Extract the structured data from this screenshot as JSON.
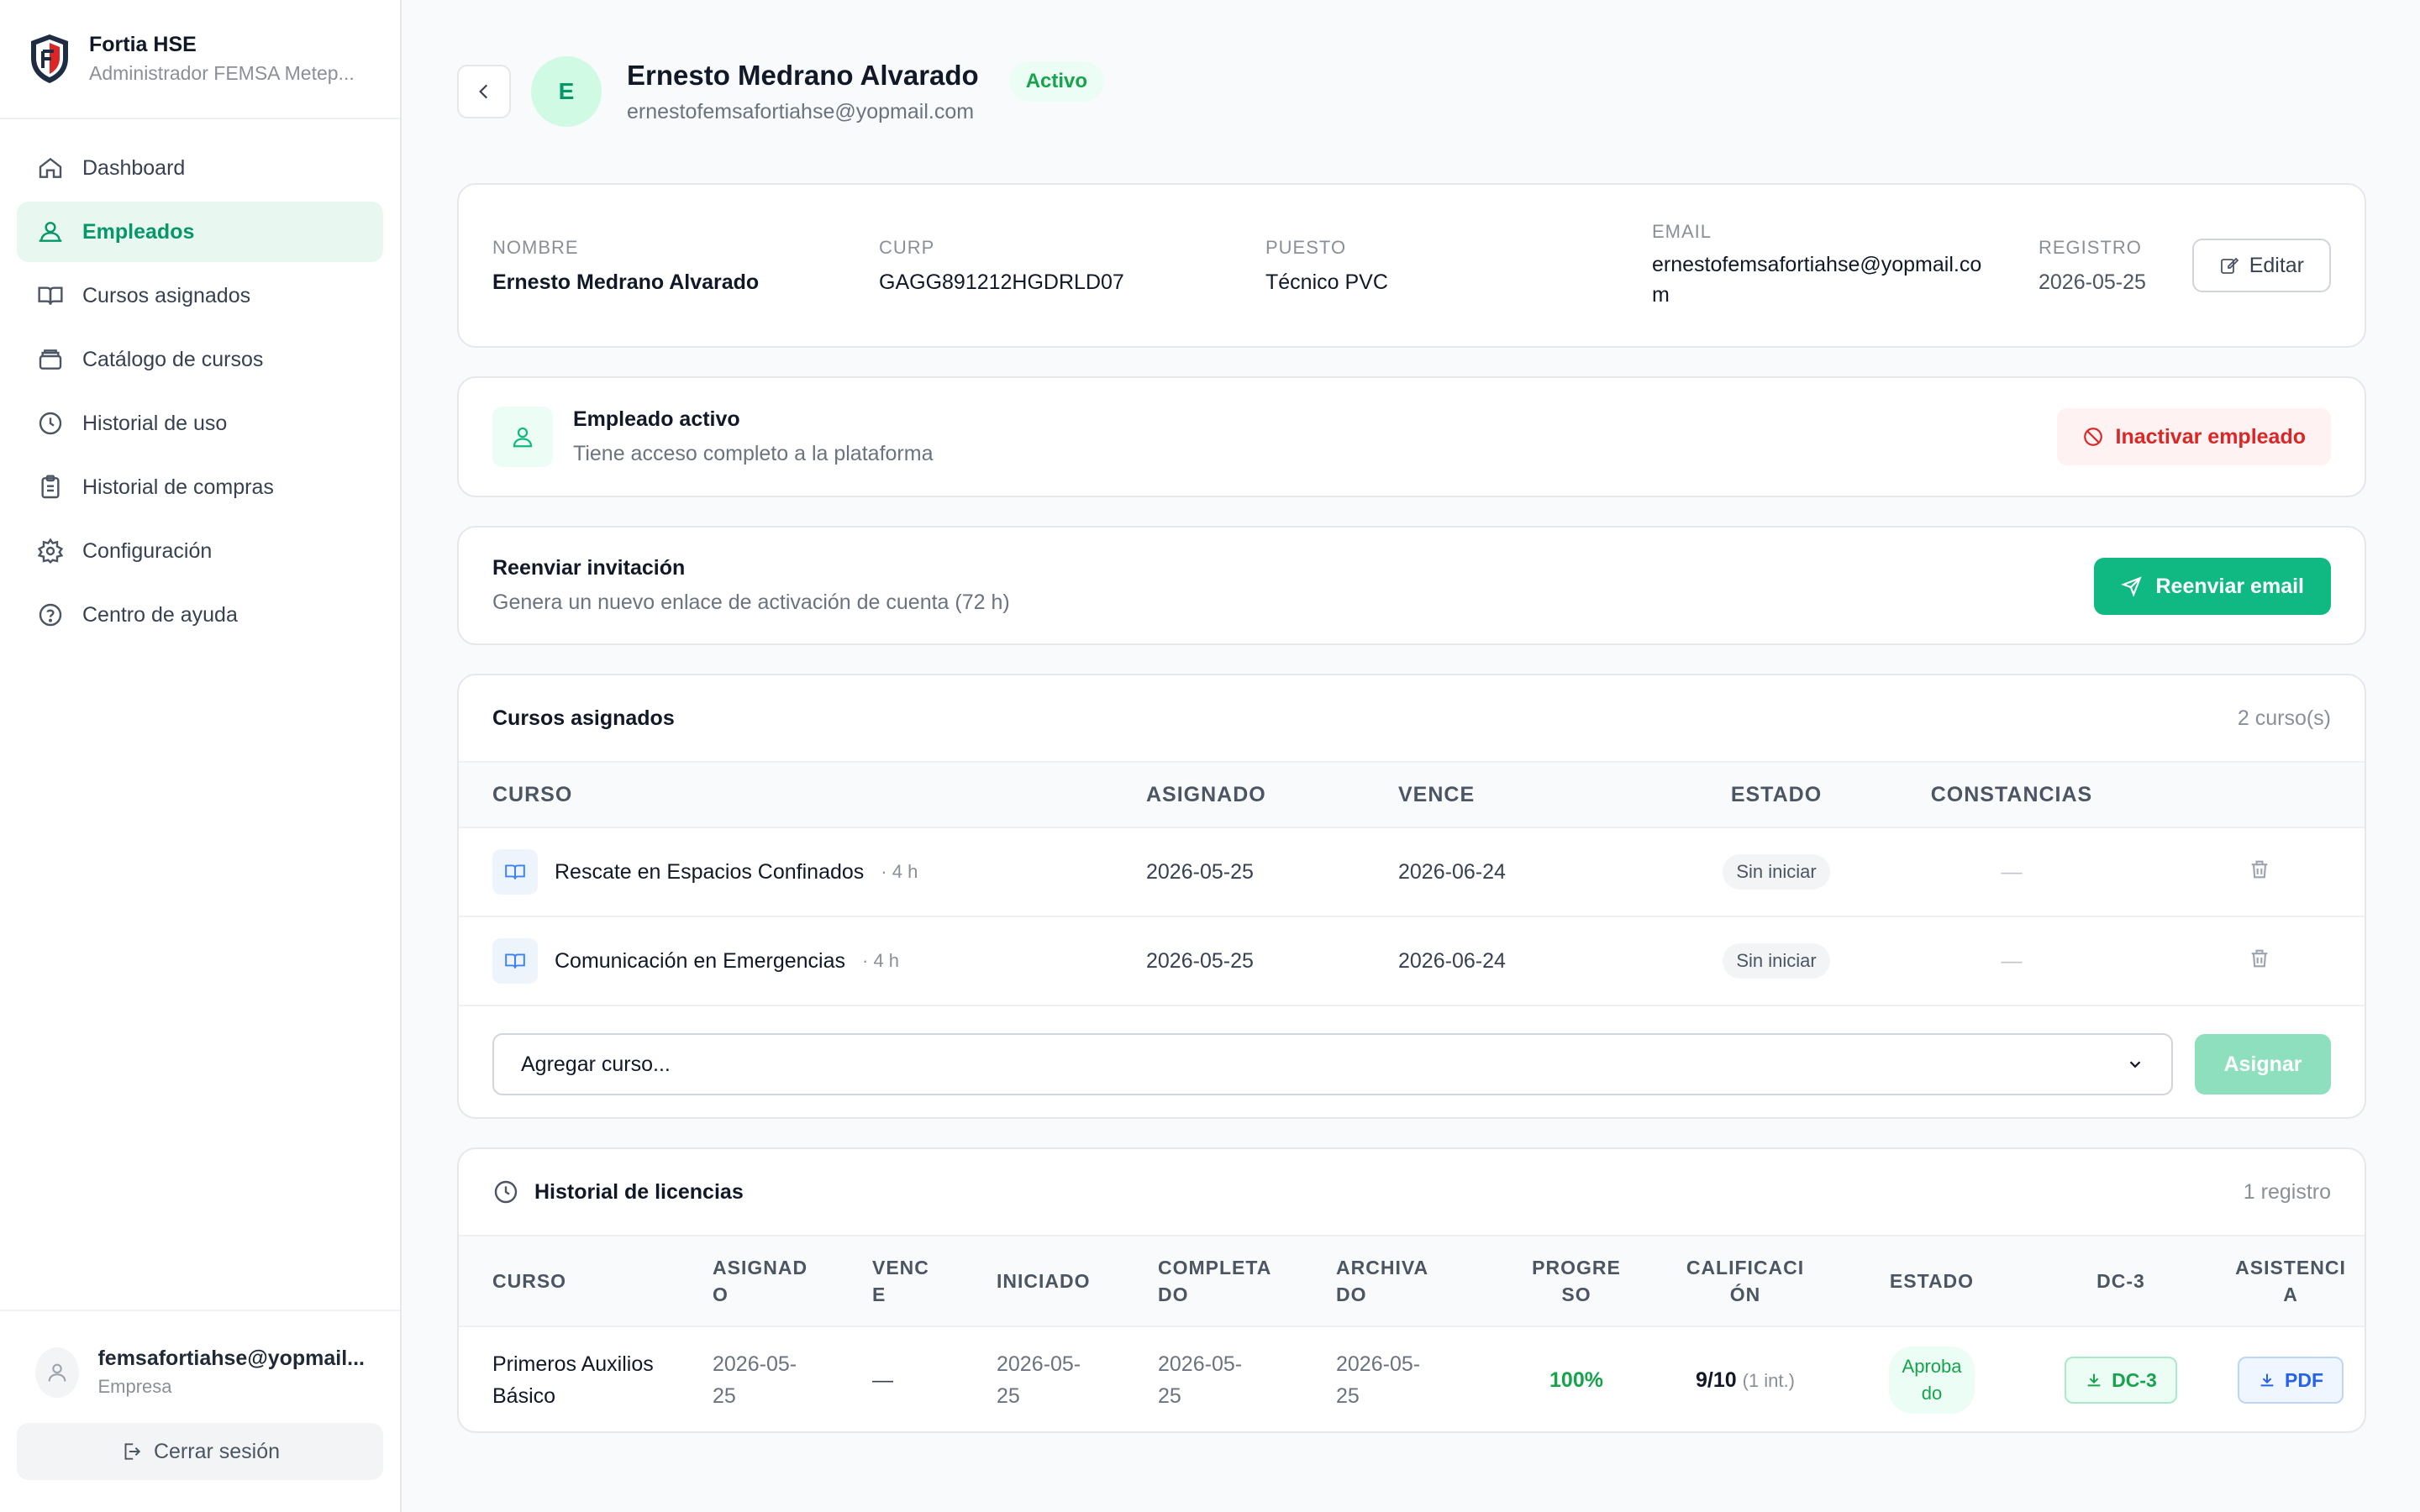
{
  "brand": {
    "name": "Fortia HSE",
    "subtitle": "Administrador FEMSA Metep..."
  },
  "nav": [
    {
      "label": "Dashboard",
      "icon": "home-icon"
    },
    {
      "label": "Empleados",
      "icon": "users-icon",
      "active": true
    },
    {
      "label": "Cursos asignados",
      "icon": "book-icon"
    },
    {
      "label": "Catálogo de cursos",
      "icon": "catalog-icon"
    },
    {
      "label": "Historial de uso",
      "icon": "clock-icon"
    },
    {
      "label": "Historial de compras",
      "icon": "clipboard-icon"
    },
    {
      "label": "Configuración",
      "icon": "gear-icon"
    },
    {
      "label": "Centro de ayuda",
      "icon": "help-icon"
    }
  ],
  "user": {
    "email": "femsafortiahse@yopmail...",
    "role": "Empresa",
    "logout": "Cerrar sesión"
  },
  "employee": {
    "initial": "E",
    "name": "Ernesto Medrano Alvarado",
    "email": "ernestofemsafortiahse@yopmail.com",
    "status": "Activo"
  },
  "info": {
    "nombre_label": "NOMBRE",
    "nombre": "Ernesto Medrano Alvarado",
    "curp_label": "CURP",
    "curp": "GAGG891212HGDRLD07",
    "puesto_label": "PUESTO",
    "puesto": "Técnico PVC",
    "email_label": "EMAIL",
    "email_line1": "ernestofemsafortiahse@yopmail.co",
    "email_line2": "m",
    "registro_label": "REGISTRO",
    "registro": "2026-05-25",
    "edit": "Editar"
  },
  "status_card": {
    "title": "Empleado activo",
    "subtitle": "Tiene acceso completo a la plataforma",
    "button": "Inactivar empleado"
  },
  "invite": {
    "title": "Reenviar invitación",
    "subtitle": "Genera un nuevo enlace de activación de cuenta (72 h)",
    "button": "Reenviar email"
  },
  "courses": {
    "title": "Cursos asignados",
    "count": "2 curso(s)",
    "headers": {
      "curso": "CURSO",
      "asignado": "ASIGNADO",
      "vence": "VENCE",
      "estado": "ESTADO",
      "constancias": "CONSTANCIAS"
    },
    "rows": [
      {
        "name": "Rescate en Espacios Confinados",
        "hours": "· 4 h",
        "asignado": "2026-05-25",
        "vence": "2026-06-24",
        "estado": "Sin iniciar",
        "constancias": "—"
      },
      {
        "name": "Comunicación en Emergencias",
        "hours": "· 4 h",
        "asignado": "2026-05-25",
        "vence": "2026-06-24",
        "estado": "Sin iniciar",
        "constancias": "—"
      }
    ],
    "select_placeholder": "Agregar curso...",
    "assign": "Asignar"
  },
  "licenses": {
    "title": "Historial de licencias",
    "count": "1 registro",
    "headers": {
      "curso": "CURSO",
      "asignado_1": "ASIGNAD",
      "asignado_2": "O",
      "vence_1": "VENC",
      "vence_2": "E",
      "iniciado": "INICIADO",
      "completado_1": "COMPLETA",
      "completado_2": "DO",
      "archivado_1": "ARCHIVA",
      "archivado_2": "DO",
      "progreso_1": "PROGRE",
      "progreso_2": "SO",
      "calificacion_1": "CALIFICACI",
      "calificacion_2": "ÓN",
      "estado": "ESTADO",
      "dc3": "DC-3",
      "asistencia_1": "ASISTENCI",
      "asistencia_2": "A"
    },
    "row": {
      "curso_1": "Primeros Auxilios",
      "curso_2": "Básico",
      "asignado_1": "2026-05-",
      "asignado_2": "25",
      "vence": "—",
      "iniciado_1": "2026-05-",
      "iniciado_2": "25",
      "completado_1": "2026-05-",
      "completado_2": "25",
      "archivado_1": "2026-05-",
      "archivado_2": "25",
      "progreso": "100%",
      "calificacion": "9/10",
      "intentos": "(1 int.)",
      "estado_1": "Aproba",
      "estado_2": "do",
      "dc3": "DC-3",
      "asistencia": "PDF"
    }
  },
  "colors": {
    "accent": "#10b981",
    "accent_light": "#e8f8f0",
    "danger": "#dc2626"
  }
}
